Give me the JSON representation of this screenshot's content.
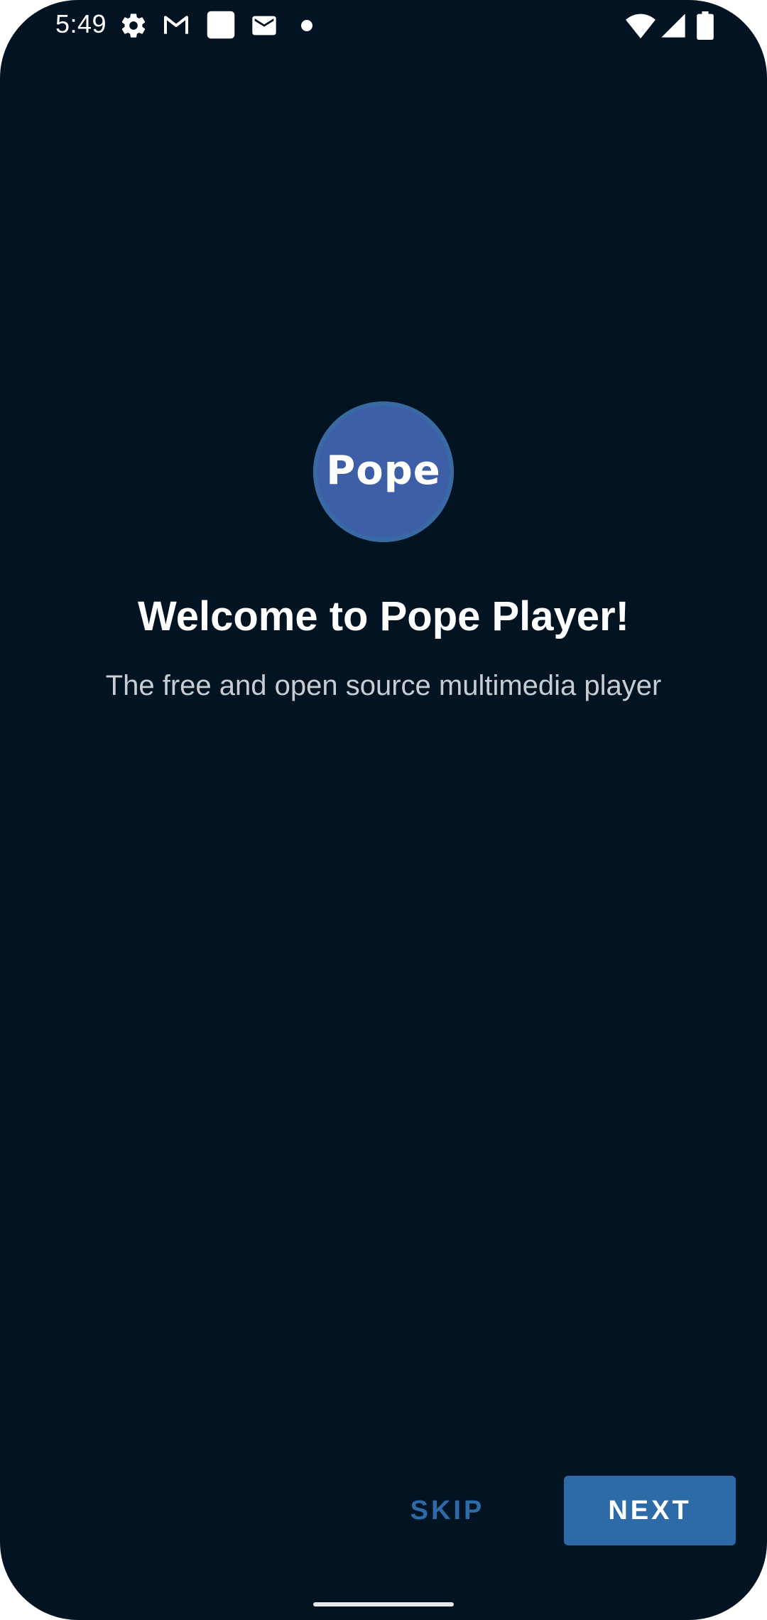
{
  "status_bar": {
    "time": "5:49",
    "icons_left": [
      "gear-icon",
      "gmail-icon",
      "square-app-icon",
      "mail-icon",
      "dot-icon"
    ],
    "icons_right": [
      "wifi-icon",
      "signal-icon",
      "battery-icon"
    ]
  },
  "onboarding": {
    "logo_text": "Pope",
    "title": "Welcome to Pope Player!",
    "subtitle": "The free and open source multimedia player"
  },
  "actions": {
    "skip_label": "SKIP",
    "next_label": "NEXT"
  },
  "colors": {
    "background": "#021321",
    "accent": "#2c6aa8",
    "logo_fill": "#3d5fa8"
  }
}
